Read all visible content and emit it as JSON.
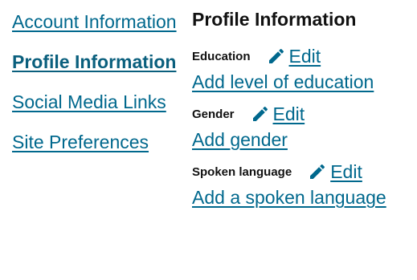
{
  "sidebar": {
    "items": [
      {
        "label": "Account Information",
        "active": false
      },
      {
        "label": "Profile Information",
        "active": true
      },
      {
        "label": "Social Media Links",
        "active": false
      },
      {
        "label": "Site Preferences",
        "active": false
      }
    ]
  },
  "main": {
    "title": "Profile Information",
    "fields": [
      {
        "label": "Education",
        "edit_label": "Edit",
        "add_label": "Add level of education"
      },
      {
        "label": "Gender",
        "edit_label": "Edit",
        "add_label": "Add gender"
      },
      {
        "label": "Spoken language",
        "edit_label": "Edit",
        "add_label": "Add a spoken language"
      }
    ]
  },
  "icons": {
    "edit": "pencil-icon"
  },
  "colors": {
    "link": "#00688d",
    "text": "#111111",
    "background": "#ffffff"
  }
}
